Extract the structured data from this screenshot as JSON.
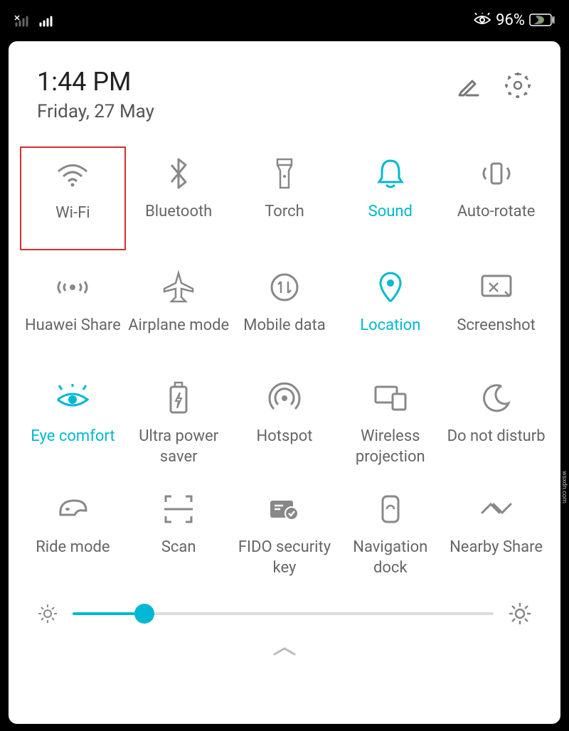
{
  "status_bar": {
    "battery_percent": "96%",
    "eye_icon": "eye-comfort-icon",
    "signal1": "no-signal",
    "signal2": "signal"
  },
  "header": {
    "time": "1:44 PM",
    "date": "Friday, 27 May"
  },
  "colors": {
    "accent": "#00b8d4",
    "highlight_border": "#d32f2f",
    "inactive": "#888888"
  },
  "tiles": [
    {
      "id": "wifi",
      "label": "Wi-Fi",
      "icon": "wifi-icon",
      "active": false,
      "highlighted": true
    },
    {
      "id": "bluetooth",
      "label": "Bluetooth",
      "icon": "bluetooth-icon",
      "active": false
    },
    {
      "id": "torch",
      "label": "Torch",
      "icon": "torch-icon",
      "active": false
    },
    {
      "id": "sound",
      "label": "Sound",
      "icon": "bell-icon",
      "active": true
    },
    {
      "id": "autorotate",
      "label": "Auto-rotate",
      "icon": "rotate-icon",
      "active": false
    },
    {
      "id": "huaweishare",
      "label": "Huawei Share",
      "icon": "share-icon",
      "active": false
    },
    {
      "id": "airplane",
      "label": "Airplane mode",
      "icon": "airplane-icon",
      "active": false
    },
    {
      "id": "mobiledata",
      "label": "Mobile data",
      "icon": "data-icon",
      "active": false
    },
    {
      "id": "location",
      "label": "Location",
      "icon": "location-icon",
      "active": true
    },
    {
      "id": "screenshot",
      "label": "Screenshot",
      "icon": "screenshot-icon",
      "active": false
    },
    {
      "id": "eyecomfort",
      "label": "Eye comfort",
      "icon": "eye-icon",
      "active": true
    },
    {
      "id": "ultrapower",
      "label": "Ultra power saver",
      "icon": "battery-saver-icon",
      "active": false
    },
    {
      "id": "hotspot",
      "label": "Hotspot",
      "icon": "hotspot-icon",
      "active": false
    },
    {
      "id": "wirelessproj",
      "label": "Wireless projection",
      "icon": "projection-icon",
      "active": false
    },
    {
      "id": "dnd",
      "label": "Do not disturb",
      "icon": "moon-icon",
      "active": false
    },
    {
      "id": "ridemode",
      "label": "Ride mode",
      "icon": "helmet-icon",
      "active": false
    },
    {
      "id": "scan",
      "label": "Scan",
      "icon": "scan-icon",
      "active": false
    },
    {
      "id": "fido",
      "label": "FIDO security key",
      "icon": "key-icon",
      "active": false
    },
    {
      "id": "navdock",
      "label": "Navigation dock",
      "icon": "navdock-icon",
      "active": false
    },
    {
      "id": "nearby",
      "label": "Nearby Share",
      "icon": "nearby-icon",
      "active": false
    }
  ],
  "brightness": {
    "value_percent": 17
  },
  "watermark": "wsxdn.com"
}
